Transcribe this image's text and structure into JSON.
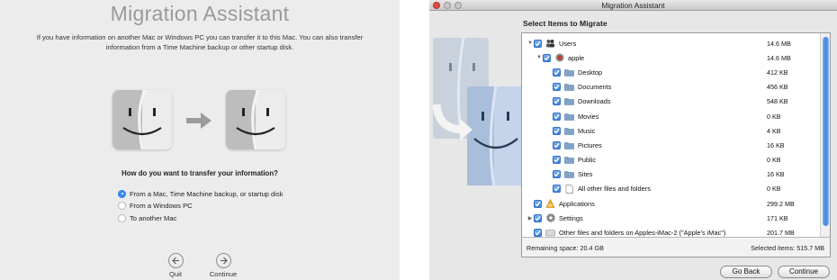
{
  "left_panel": {
    "title": "Migration Assistant",
    "description": "If you have information on another Mac or Windows PC you can transfer it to this Mac. You can also transfer information from a Time Machine backup or other startup disk.",
    "question": "How do you want to transfer your information?",
    "options": [
      {
        "label": "From a Mac, Time Machine backup, or startup disk",
        "selected": true
      },
      {
        "label": "From a Windows PC",
        "selected": false
      },
      {
        "label": "To another Mac",
        "selected": false
      }
    ],
    "quit_label": "Quit",
    "continue_label": "Continue"
  },
  "right_panel": {
    "window_title": "Migration Assistant",
    "heading": "Select Items to Migrate",
    "items": [
      {
        "name": "Users",
        "size": "14.6 MB",
        "level": 0,
        "disclosure": "open",
        "icon": "users-icon"
      },
      {
        "name": "apple",
        "size": "14.6 MB",
        "level": 1,
        "disclosure": "open",
        "icon": "user-icon"
      },
      {
        "name": "Desktop",
        "size": "412 KB",
        "level": 2,
        "disclosure": "none",
        "icon": "folder-icon"
      },
      {
        "name": "Documents",
        "size": "456 KB",
        "level": 2,
        "disclosure": "none",
        "icon": "folder-icon"
      },
      {
        "name": "Downloads",
        "size": "548 KB",
        "level": 2,
        "disclosure": "none",
        "icon": "folder-icon"
      },
      {
        "name": "Movies",
        "size": "0 KB",
        "level": 2,
        "disclosure": "none",
        "icon": "folder-icon"
      },
      {
        "name": "Music",
        "size": "4 KB",
        "level": 2,
        "disclosure": "none",
        "icon": "folder-icon"
      },
      {
        "name": "Pictures",
        "size": "16 KB",
        "level": 2,
        "disclosure": "none",
        "icon": "folder-icon"
      },
      {
        "name": "Public",
        "size": "0 KB",
        "level": 2,
        "disclosure": "none",
        "icon": "folder-icon"
      },
      {
        "name": "Sites",
        "size": "16 KB",
        "level": 2,
        "disclosure": "none",
        "icon": "folder-icon"
      },
      {
        "name": "All other files and folders",
        "size": "0 KB",
        "level": 2,
        "disclosure": "none",
        "icon": "document-icon"
      },
      {
        "name": "Applications",
        "size": "299.2 MB",
        "level": 0,
        "disclosure": "none",
        "icon": "applications-icon"
      },
      {
        "name": "Settings",
        "size": "171 KB",
        "level": 0,
        "disclosure": "closed",
        "icon": "gear-icon"
      },
      {
        "name": "Other files and folders on Apples-iMac-2 (\"Apple's iMac\")",
        "size": "201.7 MB",
        "level": 0,
        "disclosure": "none",
        "icon": "disk-icon"
      }
    ],
    "remaining_space": "Remaining space: 20.4 GB",
    "selected_items": "Selected items: 515.7 MB",
    "go_back_label": "Go Back",
    "continue_label": "Continue"
  }
}
